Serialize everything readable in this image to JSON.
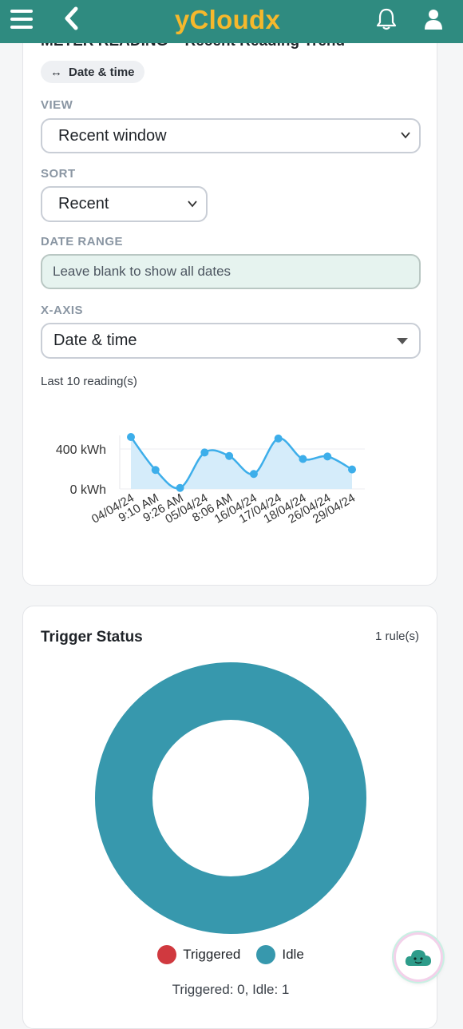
{
  "header": {
    "brand": "yCloudx",
    "menu_icon": "hamburger-icon",
    "back_icon": "chevron-left-icon",
    "bell_icon": "bell-icon",
    "user_icon": "user-icon"
  },
  "meter_card": {
    "clipped_title": "METER READING – Recent Reading Trend",
    "chip": {
      "icon": "↔",
      "label": "Date & time"
    },
    "view": {
      "label": "VIEW",
      "value": "Recent window"
    },
    "sort": {
      "label": "SORT",
      "value": "Recent"
    },
    "date_range": {
      "label": "DATE RANGE",
      "placeholder": "Leave blank to show all dates"
    },
    "x_axis": {
      "label": "X-AXIS",
      "value": "Date & time"
    },
    "reading_count": "Last 10 reading(s)"
  },
  "chart_data": {
    "type": "area",
    "categories": [
      "04/04/24",
      "9:10 AM",
      "9:26 AM",
      "05/04/24",
      "8:06 AM",
      "16/04/24",
      "17/04/24",
      "18/04/24",
      "26/04/24",
      "29/04/24"
    ],
    "series": [
      {
        "values": [
          520,
          190,
          10,
          365,
          330,
          150,
          505,
          300,
          325,
          195
        ]
      }
    ],
    "y_ticks": [
      "400 kWh",
      "0 kWh"
    ],
    "y_tick_values": [
      400,
      0
    ],
    "ylim": [
      0,
      520
    ],
    "line_color": "#3daeea",
    "fill_color": "#d5ecfa",
    "grid": true
  },
  "trigger_card": {
    "title": "Trigger Status",
    "rule_count": "1 rule(s)",
    "donut": {
      "triggered": 0,
      "idle": 1
    },
    "legend": [
      {
        "label": "Triggered",
        "color": "#d0393f"
      },
      {
        "label": "Idle",
        "color": "#3798ad"
      }
    ],
    "summary": "Triggered: 0, Idle: 1"
  },
  "assistant": {
    "icon": "cloud-assistant-icon"
  }
}
